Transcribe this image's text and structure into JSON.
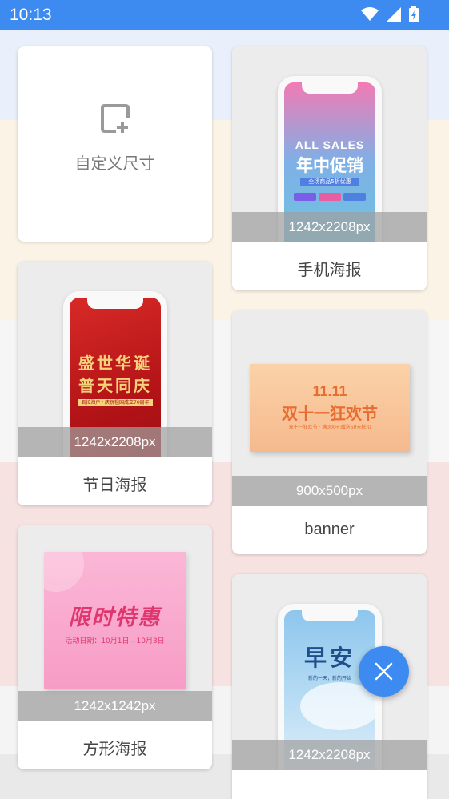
{
  "status": {
    "time": "10:13"
  },
  "custom": {
    "label": "自定义尺寸",
    "icon": "add-frame-icon"
  },
  "templates": [
    {
      "label": "手机海报",
      "size": "1242x2208px",
      "preview": {
        "line1": "ALL SALES",
        "line2": "年中促销",
        "badge": "全场商品5折优惠"
      }
    },
    {
      "label": "节日海报",
      "size": "1242x2208px",
      "preview": {
        "line1": "盛世华诞",
        "line2": "普天同庆",
        "badge": "君拉海户 · 庆祝祖国成立70周年"
      }
    },
    {
      "label": "banner",
      "size": "900x500px",
      "preview": {
        "line1": "11.11",
        "line2": "双十一狂欢节",
        "badge": "双十一狂欢节 · 满300元赠送50元抵扣"
      }
    },
    {
      "label": "方形海报",
      "size": "1242x1242px",
      "preview": {
        "line1": "限时特惠",
        "badge": "活动日期：10月1日—10月3日"
      }
    },
    {
      "label": "",
      "size": "1242x2208px",
      "preview": {
        "line1": "早安",
        "badge": "新的一天，新的开始"
      }
    }
  ],
  "fab": {
    "icon": "close-icon"
  },
  "colors": {
    "accent": "#3d8bf0",
    "festival_red": "#c81a1e",
    "gold": "#f5d37a",
    "banner_orange": "#e86c2f",
    "pink": "#f8a8cc"
  }
}
